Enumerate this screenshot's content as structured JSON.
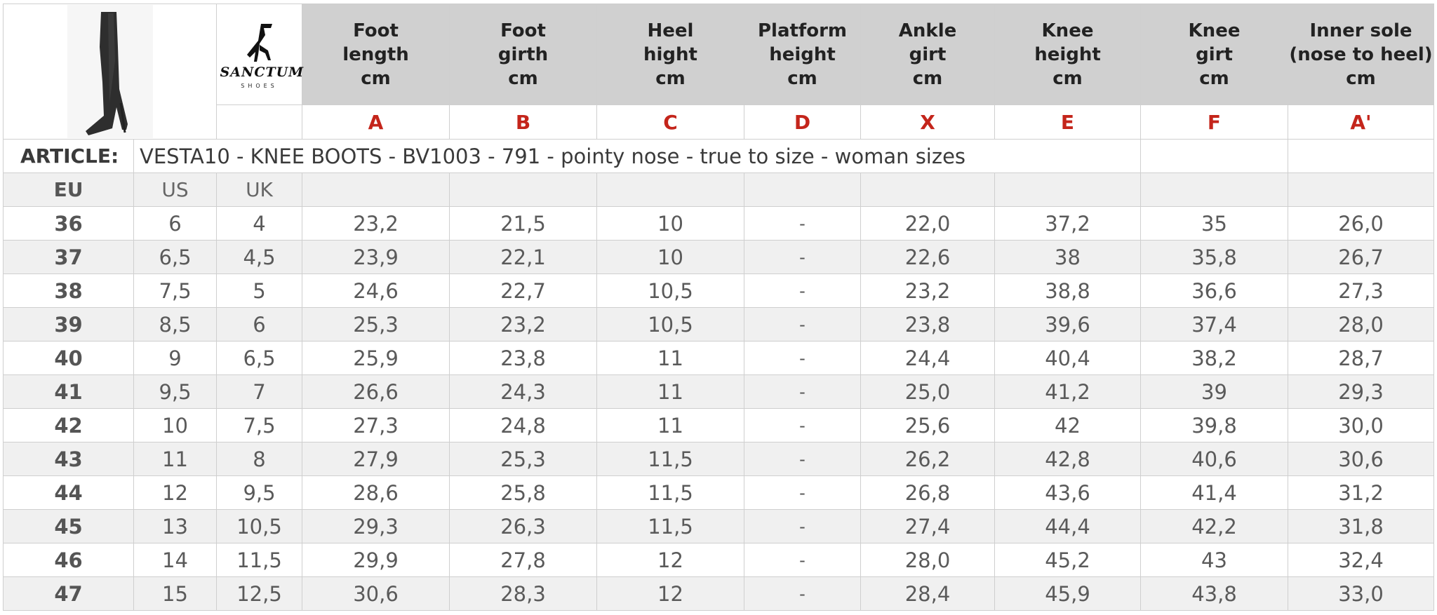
{
  "logo": {
    "brand": "SANCTUM",
    "sub": "SHOES"
  },
  "columns": [
    {
      "title": [
        "Foot",
        "length",
        "cm"
      ],
      "letter": "A"
    },
    {
      "title": [
        "Foot",
        "girth",
        "cm"
      ],
      "letter": "B"
    },
    {
      "title": [
        "Heel",
        "hight",
        "cm"
      ],
      "letter": "C"
    },
    {
      "title": [
        "Platform",
        "height",
        "cm"
      ],
      "letter": "D"
    },
    {
      "title": [
        "Ankle",
        "girt",
        "cm"
      ],
      "letter": "X"
    },
    {
      "title": [
        "Knee",
        "height",
        "cm"
      ],
      "letter": "E"
    },
    {
      "title": [
        "Knee",
        "girt",
        "cm"
      ],
      "letter": "F"
    },
    {
      "title": [
        "Inner sole",
        "(nose to heel)",
        "cm"
      ],
      "letter": "A'"
    }
  ],
  "article": {
    "label": "ARTICLE:",
    "text": "VESTA10 - KNEE BOOTS - BV1003 - 791 - pointy nose - true to size - woman sizes"
  },
  "size_labels": [
    "EU",
    "US",
    "UK"
  ],
  "rows": [
    [
      "36",
      "6",
      "4",
      "23,2",
      "21,5",
      "10",
      "-",
      "22,0",
      "37,2",
      "35",
      "26,0"
    ],
    [
      "37",
      "6,5",
      "4,5",
      "23,9",
      "22,1",
      "10",
      "-",
      "22,6",
      "38",
      "35,8",
      "26,7"
    ],
    [
      "38",
      "7,5",
      "5",
      "24,6",
      "22,7",
      "10,5",
      "-",
      "23,2",
      "38,8",
      "36,6",
      "27,3"
    ],
    [
      "39",
      "8,5",
      "6",
      "25,3",
      "23,2",
      "10,5",
      "-",
      "23,8",
      "39,6",
      "37,4",
      "28,0"
    ],
    [
      "40",
      "9",
      "6,5",
      "25,9",
      "23,8",
      "11",
      "-",
      "24,4",
      "40,4",
      "38,2",
      "28,7"
    ],
    [
      "41",
      "9,5",
      "7",
      "26,6",
      "24,3",
      "11",
      "-",
      "25,0",
      "41,2",
      "39",
      "29,3"
    ],
    [
      "42",
      "10",
      "7,5",
      "27,3",
      "24,8",
      "11",
      "-",
      "25,6",
      "42",
      "39,8",
      "30,0"
    ],
    [
      "43",
      "11",
      "8",
      "27,9",
      "25,3",
      "11,5",
      "-",
      "26,2",
      "42,8",
      "40,6",
      "30,6"
    ],
    [
      "44",
      "12",
      "9,5",
      "28,6",
      "25,8",
      "11,5",
      "-",
      "26,8",
      "43,6",
      "41,4",
      "31,2"
    ],
    [
      "45",
      "13",
      "10,5",
      "29,3",
      "26,3",
      "11,5",
      "-",
      "27,4",
      "44,4",
      "42,2",
      "31,8"
    ],
    [
      "46",
      "14",
      "11,5",
      "29,9",
      "27,8",
      "12",
      "-",
      "28,0",
      "45,2",
      "43",
      "32,4"
    ],
    [
      "47",
      "15",
      "12,5",
      "30,6",
      "28,3",
      "12",
      "-",
      "28,4",
      "45,9",
      "43,8",
      "33,0"
    ]
  ],
  "colors": {
    "header_bg": "#d0d0d0",
    "letter": "#c4251b",
    "row_alt": "#f0f0f0"
  }
}
